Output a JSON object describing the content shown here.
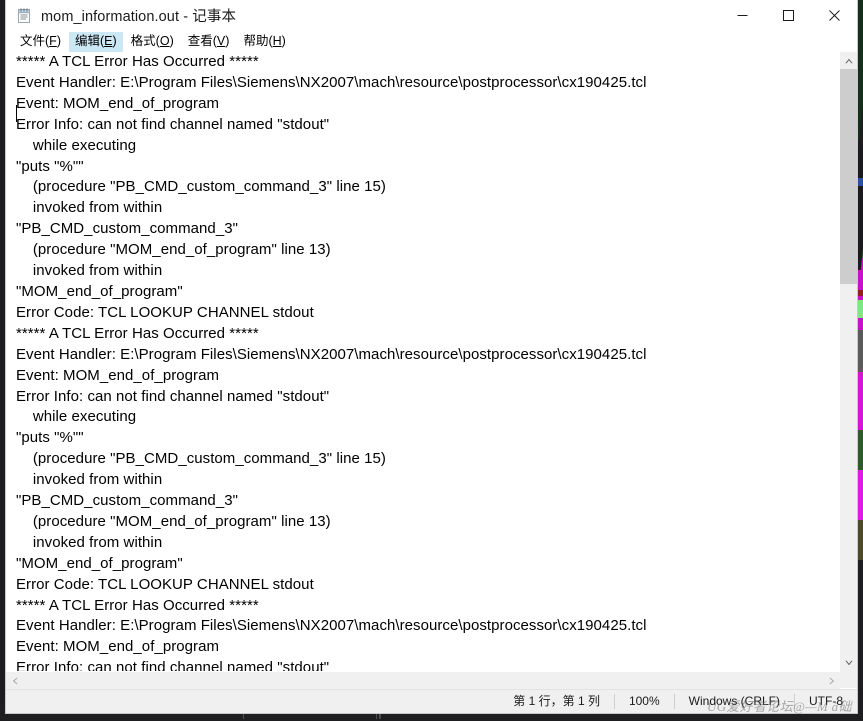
{
  "window": {
    "title": "mom_information.out - 记事本",
    "icon": "notepad-icon",
    "minimize_label": "—",
    "maximize_label": "□",
    "close_label": "✕"
  },
  "menubar": {
    "items": [
      {
        "name": "file",
        "label": "文件(F)",
        "accel": "F",
        "active": false
      },
      {
        "name": "edit",
        "label": "编辑(E)",
        "accel": "E",
        "active": true
      },
      {
        "name": "format",
        "label": "格式(O)",
        "accel": "O",
        "active": false
      },
      {
        "name": "view",
        "label": "查看(V)",
        "accel": "V",
        "active": false
      },
      {
        "name": "help",
        "label": "帮助(H)",
        "accel": "H",
        "active": false
      }
    ]
  },
  "document": {
    "filename": "mom_information.out",
    "lines": [
      "***** A TCL Error Has Occurred *****",
      "Event Handler: E:\\Program Files\\Siemens\\NX2007\\mach\\resource\\postprocessor\\cx190425.tcl",
      "Event: MOM_end_of_program",
      "Error Info: can not find channel named \"stdout\"",
      "    while executing",
      "\"puts \"%\"\"",
      "    (procedure \"PB_CMD_custom_command_3\" line 15)",
      "    invoked from within",
      "\"PB_CMD_custom_command_3\"",
      "    (procedure \"MOM_end_of_program\" line 13)",
      "    invoked from within",
      "\"MOM_end_of_program\"",
      "Error Code: TCL LOOKUP CHANNEL stdout",
      "***** A TCL Error Has Occurred *****",
      "Event Handler: E:\\Program Files\\Siemens\\NX2007\\mach\\resource\\postprocessor\\cx190425.tcl",
      "Event: MOM_end_of_program",
      "Error Info: can not find channel named \"stdout\"",
      "    while executing",
      "\"puts \"%\"\"",
      "    (procedure \"PB_CMD_custom_command_3\" line 15)",
      "    invoked from within",
      "\"PB_CMD_custom_command_3\"",
      "    (procedure \"MOM_end_of_program\" line 13)",
      "    invoked from within",
      "\"MOM_end_of_program\"",
      "Error Code: TCL LOOKUP CHANNEL stdout",
      "***** A TCL Error Has Occurred *****",
      "Event Handler: E:\\Program Files\\Siemens\\NX2007\\mach\\resource\\postprocessor\\cx190425.tcl",
      "Event: MOM_end_of_program",
      "Error Info: can not find channel named \"stdout\""
    ]
  },
  "scrollbars": {
    "vertical": {
      "up_arrow": "▲",
      "down_arrow": "▼"
    },
    "horizontal": {
      "left_arrow": "◀",
      "right_arrow": "▶"
    }
  },
  "statusbar": {
    "position": "第 1 行，第 1 列",
    "zoom": "100%",
    "line_ending": "Windows (CRLF)",
    "encoding": "UTF-8",
    "watermark": "UG爱好者论坛@—M á础"
  }
}
